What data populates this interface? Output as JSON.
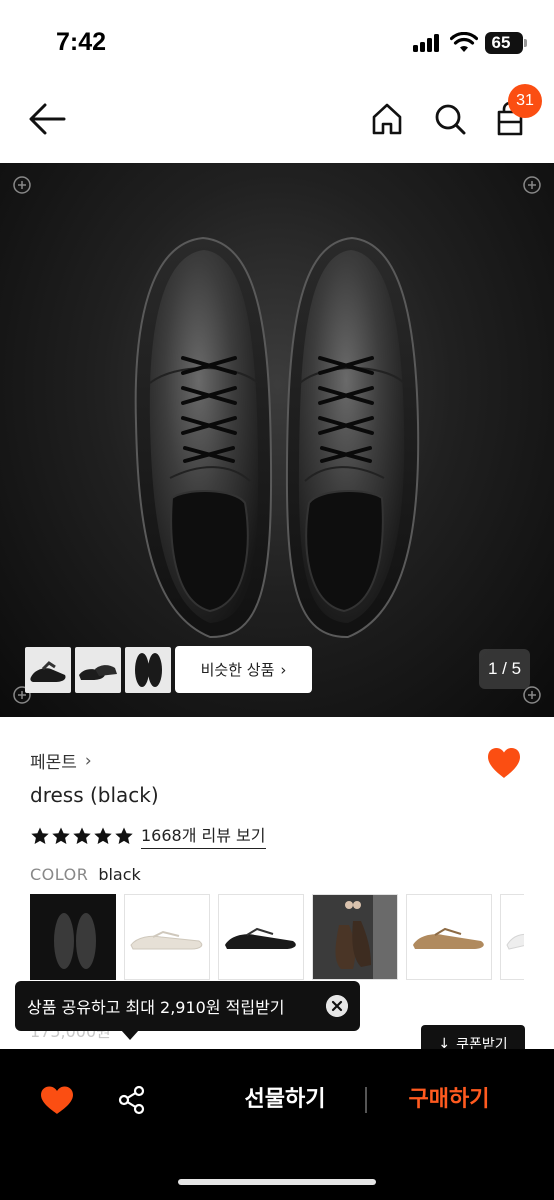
{
  "status_bar": {
    "time": "7:42",
    "battery": "65"
  },
  "nav": {
    "cart_count": "31"
  },
  "hero": {
    "page_indicator": "1 / 5",
    "similar_button_label": "비슷한 상품",
    "similar_button_arrow": "›"
  },
  "product": {
    "brand": "페몬트",
    "brand_arrow": "›",
    "name": "dress (black)",
    "rating_stars": 5,
    "review_link": "1668개 리뷰 보기",
    "color_label": "COLOR",
    "color_value": "black",
    "swatches": [
      "black",
      "cream",
      "black-low",
      "brown-hanging",
      "tan",
      "white"
    ],
    "price_faded": "175,000원",
    "coupon_label": "쿠폰받기",
    "coupon_icon": "↓"
  },
  "tooltip": {
    "text": "상품 공유하고 최대 2,910원 적립받기",
    "close_icon": "×"
  },
  "bottom_bar": {
    "gift_label": "선물하기",
    "buy_label": "구매하기"
  },
  "colors": {
    "accent": "#fb4e12",
    "buy_text": "#ff5a1f"
  }
}
